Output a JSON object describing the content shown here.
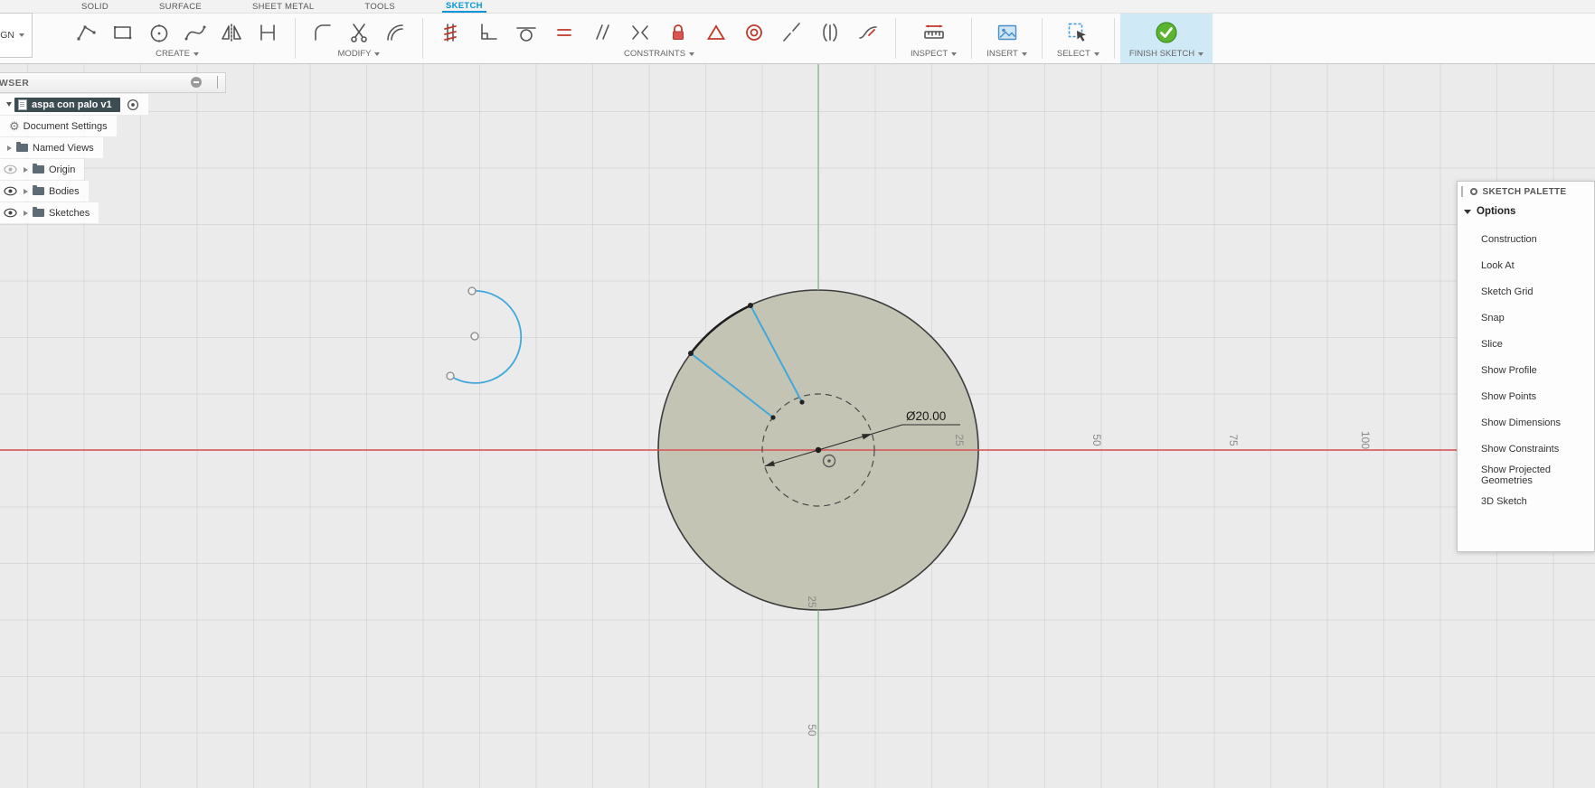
{
  "workspace": {
    "label": "DESIGN"
  },
  "tabs": [
    {
      "label": "SOLID"
    },
    {
      "label": "SURFACE"
    },
    {
      "label": "SHEET METAL"
    },
    {
      "label": "TOOLS"
    },
    {
      "label": "SKETCH",
      "active": true
    }
  ],
  "toolbar": {
    "groups": [
      {
        "label": "CREATE"
      },
      {
        "label": "MODIFY"
      },
      {
        "label": "CONSTRAINTS"
      },
      {
        "label": "INSPECT"
      },
      {
        "label": "INSERT"
      },
      {
        "label": "SELECT"
      },
      {
        "label": "FINISH SKETCH"
      }
    ]
  },
  "browser": {
    "header": "BROWSER",
    "items": [
      {
        "label": "aspa con palo v1",
        "selected": true
      },
      {
        "label": "Document Settings"
      },
      {
        "label": "Named Views"
      },
      {
        "label": "Origin",
        "hidden": true
      },
      {
        "label": "Bodies"
      },
      {
        "label": "Sketches"
      }
    ]
  },
  "sketch_palette": {
    "title": "SKETCH PALETTE",
    "section": "Options",
    "options": [
      "Construction",
      "Look At",
      "Sketch Grid",
      "Snap",
      "Slice",
      "Show Profile",
      "Show Points",
      "Show Dimensions",
      "Show Constraints",
      "Show Projected Geometries",
      "3D Sketch"
    ]
  },
  "canvas": {
    "dimension_label": "Ø20.00",
    "grid_labels_x": [
      "25",
      "50",
      "75",
      "100"
    ],
    "grid_labels_y": [
      "25",
      "50"
    ],
    "colors": {
      "axis_x": "#d95050",
      "axis_y": "#86b886",
      "profile_fill": "#c4c4b4",
      "sketch_blue": "#41a8dc",
      "accent_blue": "#0696d7",
      "finish_green": "#5cb531",
      "selected_row_bg": "#3d4b52"
    }
  },
  "icons": {
    "gear": "⚙"
  }
}
